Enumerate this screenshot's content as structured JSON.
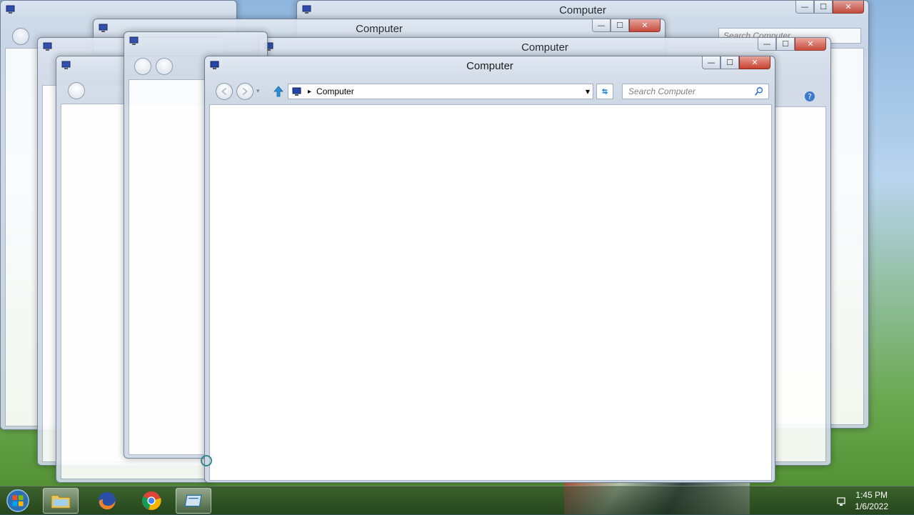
{
  "window": {
    "title": "Computer",
    "minimize_glyph": "—",
    "maximize_glyph": "☐",
    "close_glyph": "✕"
  },
  "back_windows": {
    "title": "Computer",
    "search_placeholder": "Search Computer"
  },
  "address_bar": {
    "separator": "▸",
    "location": "Computer",
    "dropdown_glyph": "▾"
  },
  "search": {
    "placeholder": "Search Computer"
  },
  "icons": {
    "computer": "computer-icon",
    "back": "back-icon",
    "forward": "forward-icon",
    "up": "up-arrow-icon",
    "refresh": "refresh-icon",
    "search": "search-icon",
    "help": "help-icon",
    "start": "windows-start-icon",
    "explorer": "folder-icon",
    "firefox": "firefox-icon",
    "chrome": "chrome-icon",
    "generic_app": "app-icon",
    "network": "network-icon"
  },
  "taskbar": {
    "time": "1:45 PM",
    "date": "1/6/2022"
  },
  "colors": {
    "close_button": "#c8412f",
    "frame": "#d5deea",
    "accent_up_arrow": "#2a8fd6"
  }
}
